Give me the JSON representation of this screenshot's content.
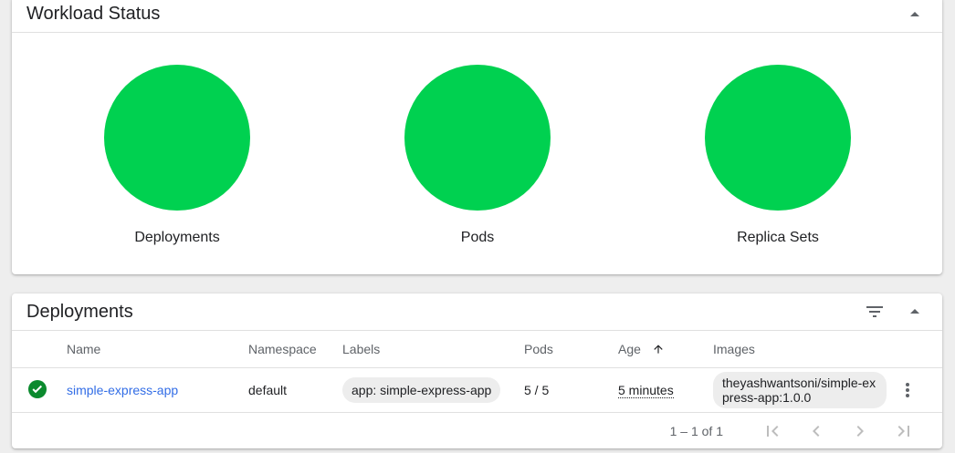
{
  "workload": {
    "title": "Workload Status",
    "items": [
      {
        "label": "Deployments",
        "color": "#00d150"
      },
      {
        "label": "Pods",
        "color": "#00d150"
      },
      {
        "label": "Replica Sets",
        "color": "#00d150"
      }
    ],
    "collapse_icon": "arrow-up-icon"
  },
  "deployments": {
    "title": "Deployments",
    "filter_icon": "filter-icon",
    "collapse_icon": "arrow-up-icon",
    "columns": [
      "Name",
      "Namespace",
      "Labels",
      "Pods",
      "Age",
      "Images"
    ],
    "sort_icon": "arrow-upward-icon",
    "rows": [
      {
        "status_icon": "check-circle-icon",
        "name": "simple-express-app",
        "namespace": "default",
        "labels": "app: simple-express-app",
        "pods": "5 / 5",
        "age": "5 minutes",
        "image": "theyashwantsoni/simple-express-app:1.0.0",
        "menu_icon": "more-vert-icon"
      }
    ],
    "paginator": {
      "range": "1 – 1 of 1"
    }
  }
}
